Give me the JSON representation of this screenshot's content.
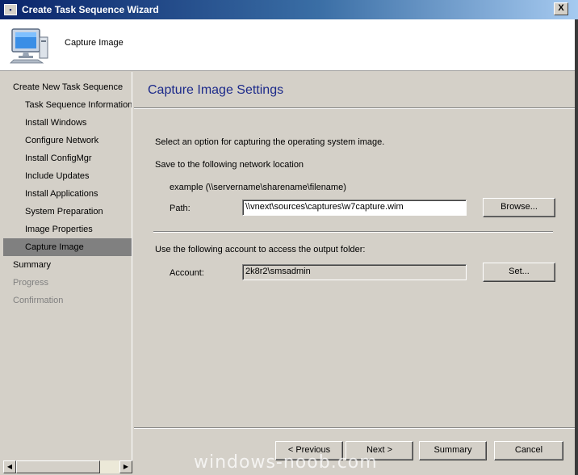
{
  "window": {
    "title": "Create Task Sequence Wizard",
    "close_label": "X"
  },
  "header": {
    "subtitle": "Capture Image",
    "icon": "computer-monitor-icon"
  },
  "sidebar": {
    "items": [
      {
        "label": "Create New Task Sequence",
        "level": 0,
        "state": "normal"
      },
      {
        "label": "Task Sequence Information",
        "level": 1,
        "state": "normal"
      },
      {
        "label": "Install Windows",
        "level": 1,
        "state": "normal"
      },
      {
        "label": "Configure Network",
        "level": 1,
        "state": "normal"
      },
      {
        "label": "Install ConfigMgr",
        "level": 1,
        "state": "normal"
      },
      {
        "label": "Include Updates",
        "level": 1,
        "state": "normal"
      },
      {
        "label": "Install Applications",
        "level": 1,
        "state": "normal"
      },
      {
        "label": "System Preparation",
        "level": 1,
        "state": "normal"
      },
      {
        "label": "Image Properties",
        "level": 1,
        "state": "normal"
      },
      {
        "label": "Capture Image",
        "level": 1,
        "state": "active"
      },
      {
        "label": "Summary",
        "level": 0,
        "state": "normal"
      },
      {
        "label": "Progress",
        "level": 0,
        "state": "disabled"
      },
      {
        "label": "Confirmation",
        "level": 0,
        "state": "disabled"
      }
    ]
  },
  "main": {
    "heading": "Capture Image Settings",
    "instruction": "Select an option for capturing the operating system image.",
    "network_location_label": "Save to the following network location",
    "example_text": "example (\\\\servername\\sharename\\filename)",
    "path_label": "Path:",
    "path_value": "\\\\vnext\\sources\\captures\\w7capture.wim",
    "browse_label": "Browse...",
    "account_intro": "Use the following account to access the output folder:",
    "account_label": "Account:",
    "account_value": "2k8r2\\smsadmin",
    "set_label": "Set..."
  },
  "footer": {
    "previous_label": "< Previous",
    "next_label": "Next >",
    "summary_label": "Summary",
    "cancel_label": "Cancel"
  },
  "watermark": "windows-noob.com"
}
